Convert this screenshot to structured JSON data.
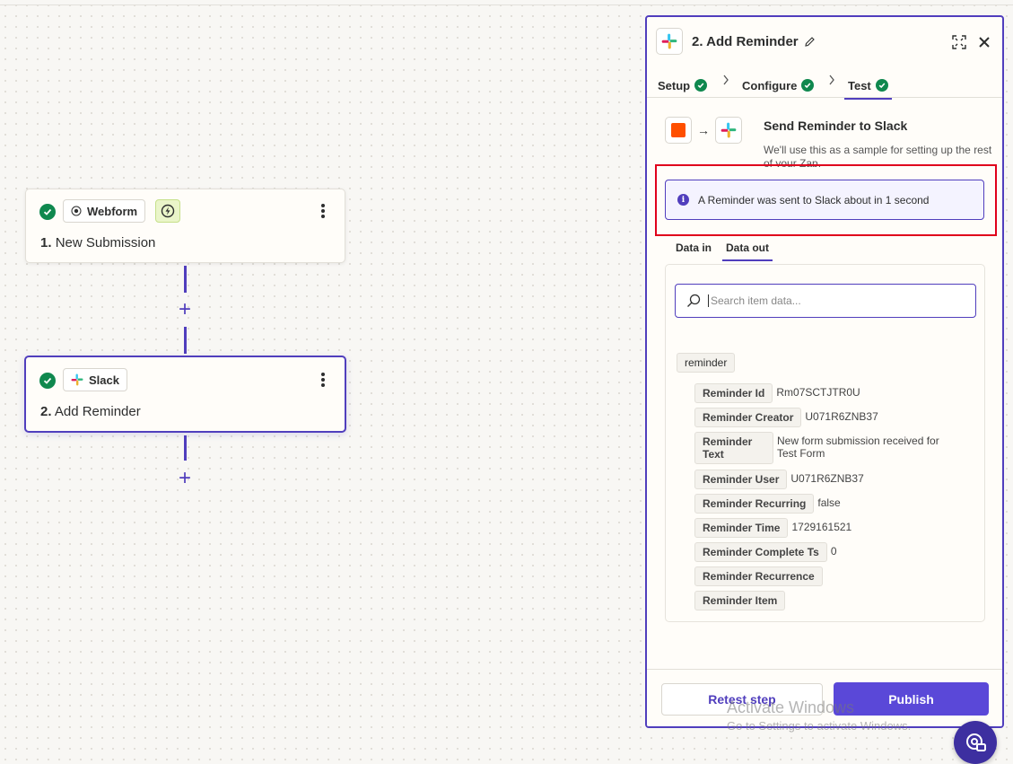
{
  "canvas": {
    "node1": {
      "number": "1.",
      "title": "New Submission",
      "app": "Webform",
      "trigger_icon": "bolt-icon"
    },
    "node2": {
      "number": "2.",
      "title": "Add Reminder",
      "app": "Slack"
    },
    "plus_label": "+"
  },
  "panel": {
    "title": "2. Add Reminder",
    "tabs": [
      {
        "label": "Setup",
        "state": "complete"
      },
      {
        "label": "Configure",
        "state": "complete"
      },
      {
        "label": "Test",
        "state": "complete",
        "active": true
      }
    ],
    "step": {
      "arrow": "→",
      "title": "Send Reminder to Slack",
      "description": "We'll use this as a sample for setting up the rest of your Zap."
    },
    "info": {
      "icon": "i",
      "message": "A Reminder was sent to Slack about in 1 second"
    },
    "data_tabs": {
      "in": "Data in",
      "out": "Data out",
      "active": "Data out"
    },
    "search": {
      "placeholder": "Search item data..."
    },
    "root_key": "reminder",
    "fields": [
      {
        "key": "Reminder Id",
        "value": "Rm07SCTJTR0U"
      },
      {
        "key": "Reminder Creator",
        "value": "U071R6ZNB37"
      },
      {
        "key": "Reminder Text",
        "value": "New form submission received for Test Form"
      },
      {
        "key": "Reminder User",
        "value": "U071R6ZNB37"
      },
      {
        "key": "Reminder Recurring",
        "value": "false"
      },
      {
        "key": "Reminder Time",
        "value": "1729161521"
      },
      {
        "key": "Reminder Complete Ts",
        "value": "0"
      },
      {
        "key": "Reminder Recurrence",
        "value": ""
      },
      {
        "key": "Reminder Item",
        "value": ""
      }
    ],
    "footer": {
      "retest_label": "Retest step",
      "publish_label": "Publish"
    }
  },
  "watermark": {
    "line1": "Activate Windows",
    "line2": "Go to Settings to activate Windows."
  },
  "colors": {
    "accent": "#503ebd",
    "success": "#0f884e",
    "zapier_orange": "#ff4f00",
    "highlight": "#e0001b"
  }
}
